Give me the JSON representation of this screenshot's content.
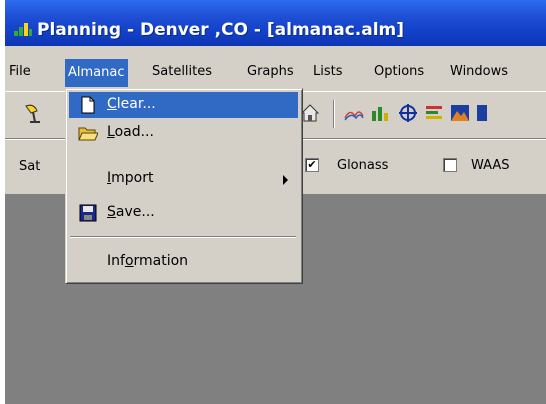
{
  "window": {
    "title": "Planning - Denver ,CO - [almanac.alm]"
  },
  "menubar": {
    "items": [
      {
        "label": "File"
      },
      {
        "label": "Almanac"
      },
      {
        "label": "Satellites"
      },
      {
        "label": "Graphs"
      },
      {
        "label": "Lists"
      },
      {
        "label": "Options"
      },
      {
        "label": "Windows"
      }
    ]
  },
  "almanac_menu": {
    "clear": {
      "mnemonic": "C",
      "rest": "lear..."
    },
    "load": {
      "mnemonic": "L",
      "rest": "oad..."
    },
    "import": {
      "mnemonic": "I",
      "rest": "mport"
    },
    "save": {
      "mnemonic": "S",
      "rest": "ave..."
    },
    "information": {
      "pre": "Inf",
      "mnemonic": "o",
      "rest": "rmation"
    }
  },
  "toolbar2": {
    "satellites_label": "Sat",
    "glonass": {
      "label": "Glonass",
      "checked": true,
      "mark": "✔"
    },
    "waas": {
      "label": "WAAS",
      "checked": false
    }
  },
  "colors": {
    "title_bar": "#1f4fd4",
    "highlight": "#316ac5",
    "workspace": "#808080"
  },
  "icons": [
    "app-planning-icon",
    "antenna-icon",
    "house-icon",
    "sky-plot-icon",
    "bar-chart-icon",
    "globe-icon",
    "list-icon",
    "mountain-icon",
    "new-document-icon",
    "open-folder-icon",
    "floppy-disk-icon"
  ]
}
